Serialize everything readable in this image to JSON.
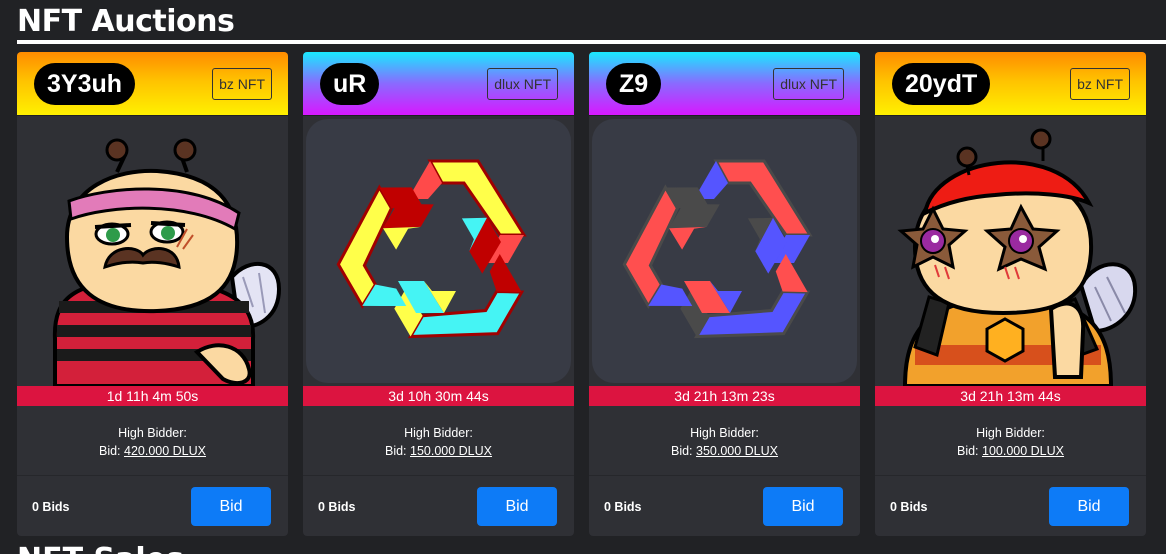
{
  "page": {
    "title": "NFT Auctions",
    "next_section_title": "NFT Sales"
  },
  "labels": {
    "high_bidder": "High Bidder:",
    "bid_prefix": "Bid: ",
    "bid_button": "Bid"
  },
  "colors": {
    "timer_bg": "#dc1440",
    "bid_button": "#0d7bf7",
    "card_bg": "#2f3035"
  },
  "cards": [
    {
      "name": "3Y3uh",
      "type": "bz NFT",
      "timer": "1d 11h 4m 50s",
      "bid": "420.000 DLUX",
      "bids": "0 Bids",
      "art_icon": "bee-character-icon"
    },
    {
      "name": "uR",
      "type": "dlux NFT",
      "timer": "3d 10h 30m 44s",
      "bid": "150.000 DLUX",
      "bids": "0 Bids",
      "art_icon": "impossible-triangle-icon"
    },
    {
      "name": "Z9",
      "type": "dlux NFT",
      "timer": "3d 21h 13m 23s",
      "bid": "350.000 DLUX",
      "bids": "0 Bids",
      "art_icon": "impossible-triangle-icon"
    },
    {
      "name": "20ydT",
      "type": "bz NFT",
      "timer": "3d 21h 13m 44s",
      "bid": "100.000 DLUX",
      "bids": "0 Bids",
      "art_icon": "bee-character-icon"
    }
  ]
}
